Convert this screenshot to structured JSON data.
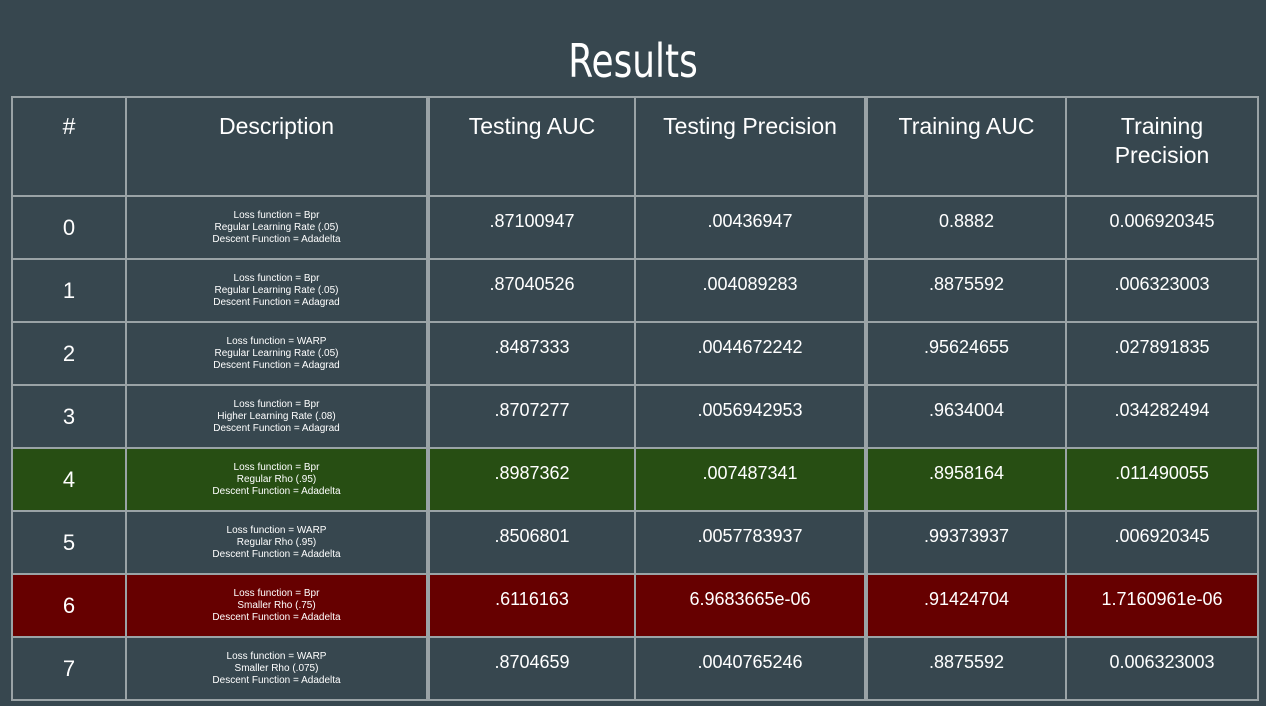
{
  "title": "Results",
  "table": {
    "headers": [
      "#",
      "Description",
      "Testing AUC",
      "Testing Precision",
      "Training AUC",
      "Training\nPrecision"
    ],
    "rows": [
      {
        "num": "0",
        "desc": [
          "Loss function = Bpr",
          "Regular Learning Rate (.05)",
          "Descent Function  = Adadelta"
        ],
        "testing_auc": ".87100947",
        "testing_precision": ".00436947",
        "training_auc": "0.8882",
        "training_precision": "0.006920345",
        "highlight": "none"
      },
      {
        "num": "1",
        "desc": [
          "Loss function = Bpr",
          "Regular Learning Rate (.05)",
          "Descent Function  = Adagrad"
        ],
        "testing_auc": ".87040526",
        "testing_precision": ".004089283",
        "training_auc": ".8875592",
        "training_precision": ".006323003",
        "highlight": "none"
      },
      {
        "num": "2",
        "desc": [
          "Loss function = WARP",
          "Regular Learning Rate (.05)",
          "Descent Function  = Adagrad"
        ],
        "testing_auc": ".8487333",
        "testing_precision": ".0044672242",
        "training_auc": ".95624655",
        "training_precision": ".027891835",
        "highlight": "none"
      },
      {
        "num": "3",
        "desc": [
          "Loss function  = Bpr",
          "Higher Learning Rate (.08)",
          "Descent Function  = Adagrad"
        ],
        "testing_auc": ".8707277",
        "testing_precision": ".0056942953",
        "training_auc": ".9634004",
        "training_precision": ".034282494",
        "highlight": "none"
      },
      {
        "num": "4",
        "desc": [
          "Loss function = Bpr",
          "Regular Rho (.95)",
          "Descent Function  = Adadelta"
        ],
        "testing_auc": ".8987362",
        "testing_precision": ".007487341",
        "training_auc": ".8958164",
        "training_precision": ".011490055",
        "highlight": "green"
      },
      {
        "num": "5",
        "desc": [
          "Loss function = WARP",
          "Regular Rho (.95)",
          "Descent Function  = Adadelta"
        ],
        "testing_auc": ".8506801",
        "testing_precision": ".0057783937",
        "training_auc": ".99373937",
        "training_precision": ".006920345",
        "highlight": "none"
      },
      {
        "num": "6",
        "desc": [
          "Loss function = Bpr",
          "Smaller Rho (.75)",
          "Descent Function  = Adadelta"
        ],
        "testing_auc": ".6116163",
        "testing_precision": "6.9683665e-06",
        "training_auc": ".91424704",
        "training_precision": "1.7160961e-06",
        "highlight": "red"
      },
      {
        "num": "7",
        "desc": [
          "Loss function = WARP",
          "Smaller Rho (.075)",
          "Descent Function  = Adadelta"
        ],
        "testing_auc": ".8704659",
        "testing_precision": ".0040765246",
        "training_auc": ".8875592",
        "training_precision": "0.006323003",
        "highlight": "none"
      }
    ]
  },
  "colors": {
    "background": "#37474f",
    "grid": "#9aa3a6",
    "best_row": "#274e13",
    "worst_row": "#660000",
    "text": "#ffffff"
  }
}
